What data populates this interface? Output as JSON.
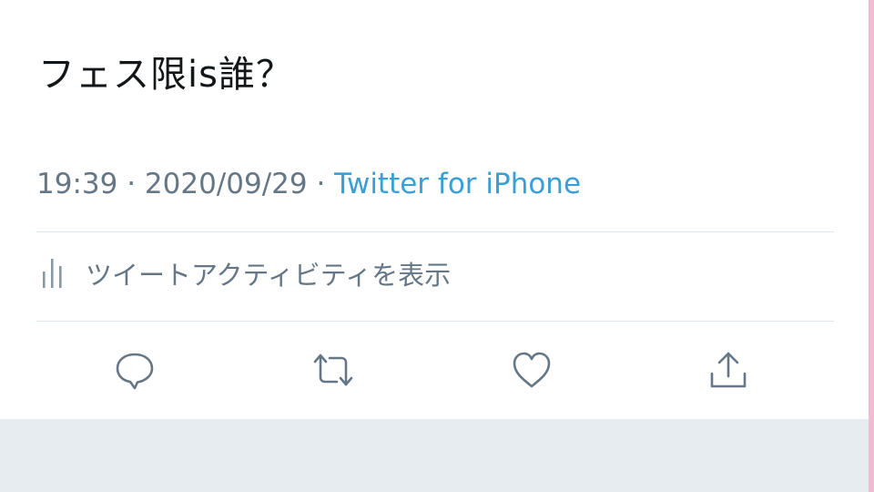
{
  "tweet": {
    "text": "フェス限is誰？",
    "time": "19:39",
    "date": "2020/09/29",
    "separator": " · ",
    "source": "Twitter for iPhone"
  },
  "activity": {
    "label": "ツイートアクティビティを表示",
    "icon": "bar-chart-icon"
  },
  "actions": [
    {
      "name": "reply",
      "icon": "speech-bubble-icon"
    },
    {
      "name": "retweet",
      "icon": "retweet-icon"
    },
    {
      "name": "like",
      "icon": "heart-icon"
    },
    {
      "name": "share",
      "icon": "share-upload-icon"
    }
  ],
  "colors": {
    "text": "#14171a",
    "secondary": "#657786",
    "link": "#3a9fd6",
    "divider": "#e1e8ed",
    "background_below": "#e6ecf0",
    "edge_accent": "#f0bcd2"
  }
}
